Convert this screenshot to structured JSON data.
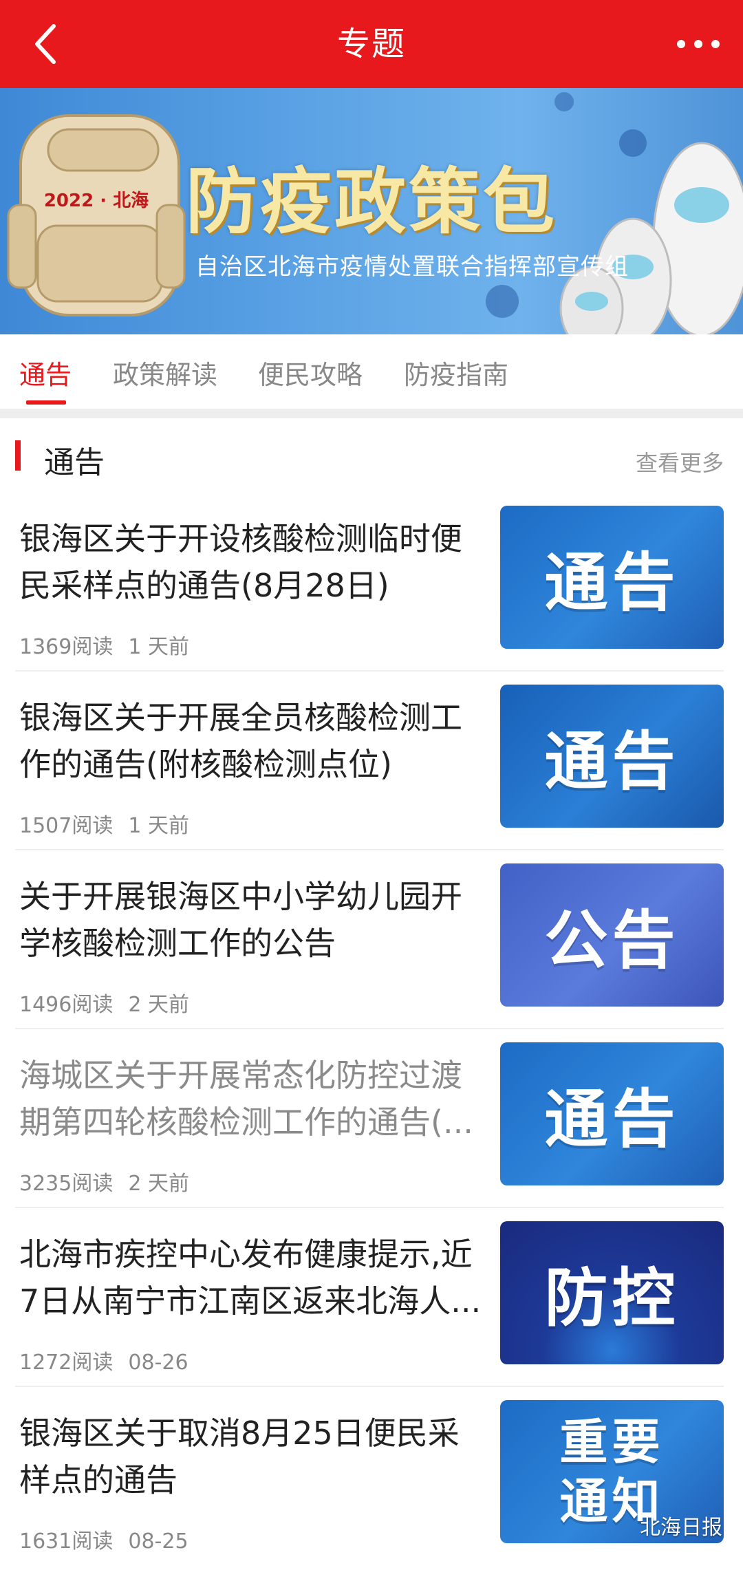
{
  "header": {
    "title": "专题"
  },
  "banner": {
    "title": "防疫政策包",
    "subtitle": "自治区北海市疫情处置联合指挥部宣传组",
    "bag_text": "2022 · 北海"
  },
  "tabs": [
    {
      "label": "通告",
      "active": true
    },
    {
      "label": "政策解读",
      "active": false
    },
    {
      "label": "便民攻略",
      "active": false
    },
    {
      "label": "防疫指南",
      "active": false
    }
  ],
  "section": {
    "title": "通告",
    "more": "查看更多"
  },
  "articles": [
    {
      "title": "银海区关于开设核酸检测临时便民采样点的通告(8月28日)",
      "reads": "1369阅读",
      "time": "1 天前",
      "thumb": "通告",
      "read": false
    },
    {
      "title": "银海区关于开展全员核酸检测工作的通告(附核酸检测点位)",
      "reads": "1507阅读",
      "time": "1 天前",
      "thumb": "通告",
      "read": false
    },
    {
      "title": "关于开展银海区中小学幼儿园开学核酸检测工作的公告",
      "reads": "1496阅读",
      "time": "2 天前",
      "thumb": "公告",
      "read": false
    },
    {
      "title": "海城区关于开展常态化防控过渡期第四轮核酸检测工作的通告(...",
      "reads": "3235阅读",
      "time": "2 天前",
      "thumb": "通告",
      "read": true
    },
    {
      "title": "北海市疾控中心发布健康提示,近7日从南宁市江南区返来北海人...",
      "reads": "1272阅读",
      "time": "08-26",
      "thumb": "防控",
      "read": false
    },
    {
      "title": "银海区关于取消8月25日便民采样点的通告",
      "reads": "1631阅读",
      "time": "08-25",
      "thumb": "重要通知",
      "read": false
    }
  ],
  "watermark": "北海日报",
  "colors": {
    "brand_red": "#e8191d",
    "thumb_blue": "#1f6fc8",
    "thumb_purple": "#4a5fc4",
    "thumb_navy": "#1c2f8a"
  },
  "icons": {
    "back": "chevron-left-icon",
    "more": "more-dots-icon"
  }
}
